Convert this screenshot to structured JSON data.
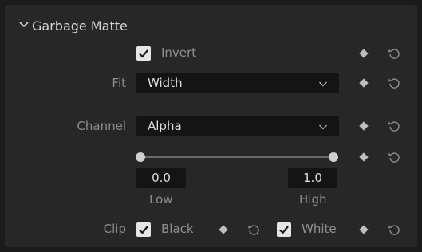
{
  "section": {
    "title": "Garbage Matte"
  },
  "invert": {
    "label": "Invert",
    "checked": true
  },
  "fit": {
    "label": "Fit",
    "value": "Width"
  },
  "channel": {
    "label": "Channel",
    "value": "Alpha"
  },
  "range": {
    "low_value": "0.0",
    "high_value": "1.0",
    "low_label": "Low",
    "high_label": "High",
    "low": 0.0,
    "high": 1.0
  },
  "clip": {
    "label": "Clip",
    "black": {
      "label": "Black",
      "checked": true
    },
    "white": {
      "label": "White",
      "checked": true
    }
  },
  "icons": {
    "collapse": "chevron-down-icon",
    "keyframe": "keyframe-diamond-icon",
    "reset": "reset-icon",
    "dropdown": "chevron-down-icon",
    "check": "checkmark-icon"
  },
  "colors": {
    "background": "#272727",
    "field": "#141414",
    "checkbox": "#e6e6e6"
  }
}
